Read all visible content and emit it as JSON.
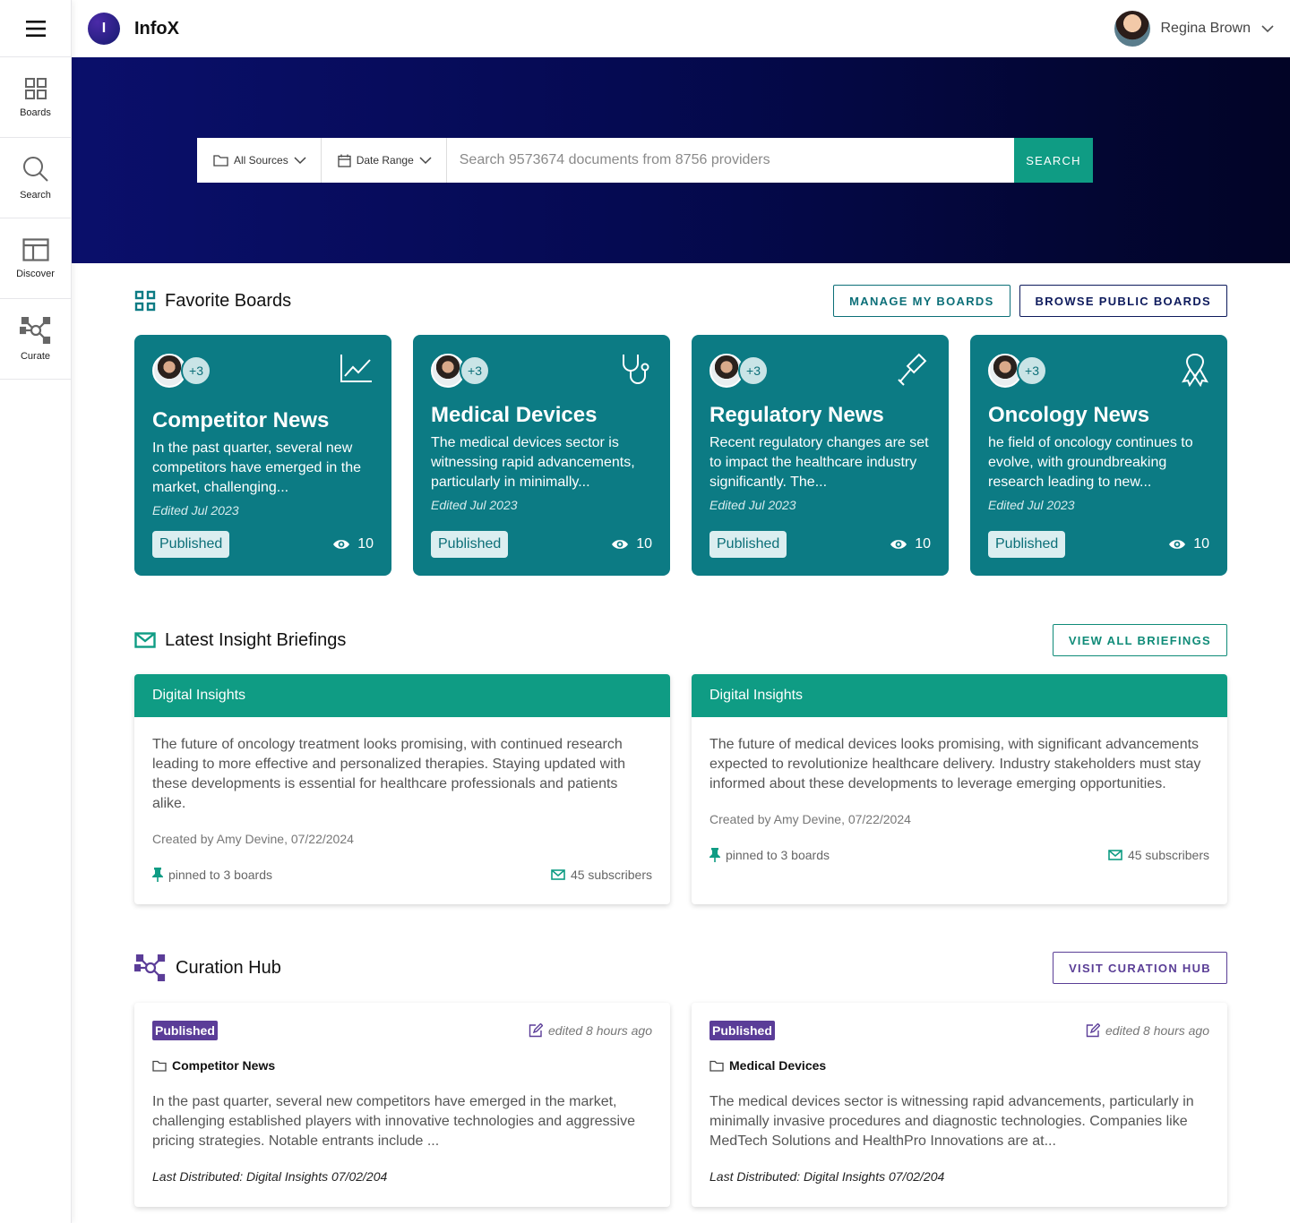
{
  "app": {
    "logo_letter": "I",
    "name": "InfoX"
  },
  "user": {
    "name": "Regina Brown"
  },
  "sidebar": {
    "items": [
      {
        "label": "Boards",
        "icon": "grid-icon"
      },
      {
        "label": "Search",
        "icon": "search-icon"
      },
      {
        "label": "Discover",
        "icon": "layout-icon"
      },
      {
        "label": "Curate",
        "icon": "network-icon"
      }
    ]
  },
  "search": {
    "sources_label": "All Sources",
    "date_label": "Date Range",
    "placeholder": "Search 9573674 documents from 8756 providers",
    "button_label": "SEARCH"
  },
  "favorite_boards": {
    "title": "Favorite Boards",
    "manage_label": "MANAGE MY BOARDS",
    "browse_label": "BROWSE PUBLIC BOARDS",
    "cards": [
      {
        "more": "+3",
        "icon": "chart-line-icon",
        "title": "Competitor News",
        "description": " In the past quarter, several new competitors have emerged in the market, challenging...",
        "edited": "Edited Jul 2023",
        "status": "Published",
        "views": "10"
      },
      {
        "more": "+3",
        "icon": "stethoscope-icon",
        "title": "Medical Devices",
        "description": "The medical devices sector is witnessing rapid advancements, particularly in minimally...",
        "edited": "Edited Jul 2023",
        "status": "Published",
        "views": "10"
      },
      {
        "more": "+3",
        "icon": "gavel-icon",
        "title": "Regulatory News",
        "description": "Recent regulatory changes are set to impact the healthcare industry significantly. The...",
        "edited": "Edited Jul 2023",
        "status": "Published",
        "views": "10"
      },
      {
        "more": "+3",
        "icon": "ribbon-icon",
        "title": "Oncology News",
        "description": "he field of oncology continues to evolve, with groundbreaking research leading to new...",
        "edited": "Edited Jul 2023",
        "status": "Published",
        "views": "10"
      }
    ]
  },
  "briefings": {
    "title": "Latest Insight Briefings",
    "view_all_label": "VIEW ALL BRIEFINGS",
    "cards": [
      {
        "header": "Digital Insights",
        "text": "The future of oncology treatment looks promising, with continued research leading to more effective and personalized therapies. Staying updated with these developments is essential for healthcare professionals and patients alike.",
        "created": "Created by Amy Devine, 07/22/2024",
        "pinned": "pinned to 3 boards",
        "subscribers": "45 subscribers"
      },
      {
        "header": "Digital Insights",
        "text": "The future of medical devices looks promising, with significant advancements expected to revolutionize healthcare delivery. Industry stakeholders must stay informed about these developments to leverage emerging opportunities.",
        "created": "Created by Amy Devine, 07/22/2024",
        "pinned": "pinned to 3 boards",
        "subscribers": "45 subscribers"
      }
    ]
  },
  "curation": {
    "title": "Curation Hub",
    "visit_label": "VISIT CURATION HUB",
    "cards": [
      {
        "status": "Published",
        "edited": "edited 8 hours ago",
        "board": "Competitor News",
        "text": "In the past quarter, several new competitors have emerged in the market, challenging established players with innovative technologies and aggressive pricing strategies. Notable entrants include ...",
        "distributed": "Last Distributed: Digital Insights 07/02/204"
      },
      {
        "status": "Published",
        "edited": "edited 8 hours ago",
        "board": "Medical Devices",
        "text": "The medical devices sector is witnessing rapid advancements, particularly in minimally invasive procedures and diagnostic technologies. Companies like MedTech Solutions and HealthPro Innovations are at...",
        "distributed": "Last Distributed: Digital Insights 07/02/204"
      }
    ]
  },
  "colors": {
    "teal_card": "#0c7b84",
    "green_accent": "#0f9c84",
    "navy_hero": "#0a0f6b",
    "purple_accent": "#5b3d98"
  }
}
